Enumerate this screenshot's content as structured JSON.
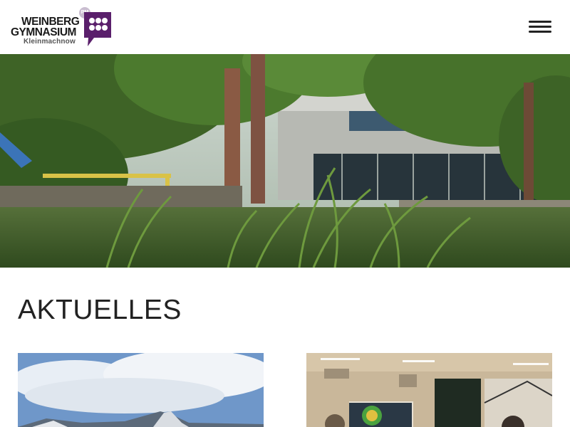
{
  "header": {
    "logo": {
      "line1": "WEINBERG",
      "line2": "GYMNASIUM",
      "line3": "Kleinmachnow",
      "badge": "PM",
      "brand_color": "#5a1f6b"
    },
    "menu_icon": "hamburger-menu-icon"
  },
  "hero": {
    "image": "school-building-with-trees-and-grass"
  },
  "section": {
    "title": "AKTUELLES"
  },
  "cards": [
    {
      "image": "mountain-landscape-under-sky"
    },
    {
      "image": "classroom-with-display-screen"
    }
  ]
}
